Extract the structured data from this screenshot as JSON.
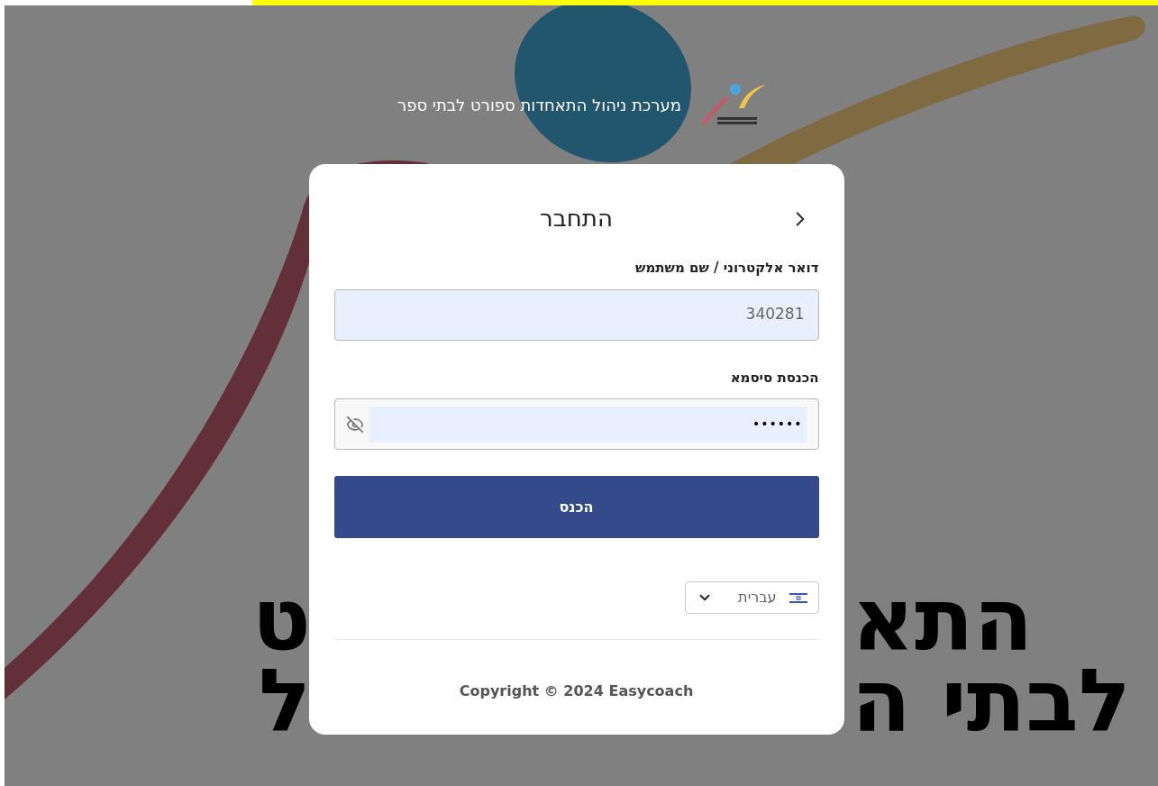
{
  "header": {
    "title": "מערכת ניהול התאחדות ספורט לבתי ספר"
  },
  "background_text": {
    "line_1_right": "התא",
    "line_1_left": "ט",
    "line_2_right": "לבתי ה",
    "line_2_left": "ל"
  },
  "login": {
    "title": "התחבר",
    "username": {
      "label": "דואר אלקטרוני / שם משתמש",
      "value": "340281"
    },
    "password": {
      "label": "הכנסת סיסמא",
      "value": "••••••"
    },
    "submit": "הכנס",
    "language": {
      "value": "עברית"
    },
    "footer": "Copyright © 2024 Easycoach"
  }
}
